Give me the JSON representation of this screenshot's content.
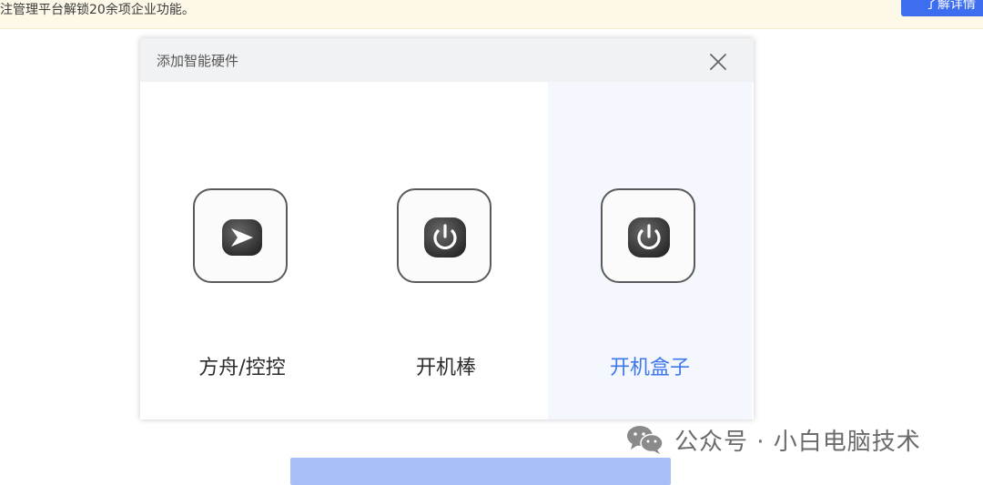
{
  "banner": {
    "text": "注管理平台解锁20余项企业功能。",
    "button_label": "了解详情"
  },
  "dialog": {
    "title": "添加智能硬件",
    "close_icon": "close-icon",
    "options": [
      {
        "label": "方舟/控控",
        "icon": "arrow-play-icon",
        "selected": false
      },
      {
        "label": "开机棒",
        "icon": "power-icon",
        "selected": false
      },
      {
        "label": "开机盒子",
        "icon": "power-icon",
        "selected": true
      }
    ]
  },
  "colors": {
    "selected_text": "#3f76e8",
    "selected_bg": "#f4f8fe",
    "confirm_button": "#a7bff6",
    "banner_bg": "#fdf8e7"
  },
  "watermark": {
    "text": "公众号 · 小白电脑技术",
    "icon": "wechat-icon"
  }
}
